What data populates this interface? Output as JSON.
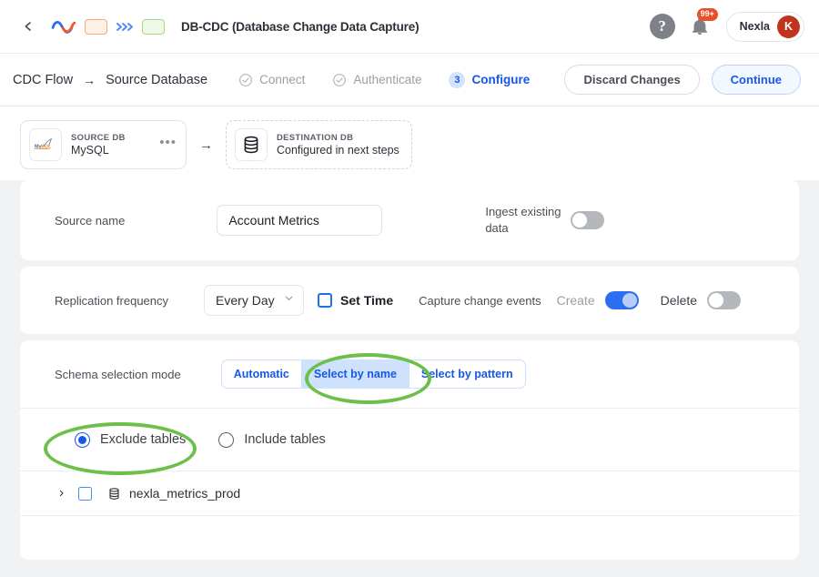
{
  "topbar": {
    "back_icon": "chevron-left-icon",
    "logo_icon": "nexla-zigzag-logo",
    "chip_orange": "",
    "chevrons_icon": "triple-chevron-right-icon",
    "chip_green": "",
    "title": "DB-CDC (Database Change Data Capture)",
    "help_label": "?",
    "bell_icon": "bell-icon",
    "notification_count": "99+",
    "user_name": "Nexla",
    "avatar_initial": "K"
  },
  "steprow": {
    "breadcrumb_root": "CDC Flow",
    "breadcrumb_arrow": "→",
    "breadcrumb_current": "Source Database",
    "steps": [
      {
        "label": "Connect",
        "state": "done"
      },
      {
        "label": "Authenticate",
        "state": "done"
      },
      {
        "label": "Configure",
        "state": "active",
        "number": "3"
      }
    ],
    "discard_label": "Discard Changes",
    "continue_label": "Continue"
  },
  "dbstrip": {
    "source": {
      "kicker": "SOURCE DB",
      "name": "MySQL",
      "logo_icon": "mysql-logo",
      "menu_icon": "ellipsis-icon"
    },
    "arrow": "→",
    "destination": {
      "kicker": "DESTINATION DB",
      "name": "Configured in next steps",
      "icon": "database-icon"
    }
  },
  "form": {
    "source_name": {
      "label": "Source name",
      "value": "Account Metrics",
      "placeholder": "Source name"
    },
    "ingest_existing": {
      "label": "Ingest existing data",
      "label_line1": "Ingest existing",
      "label_line2": "data",
      "enabled": false
    },
    "replication": {
      "label": "Replication frequency",
      "value": "Every Day",
      "options": [
        "Every Day"
      ],
      "set_time_label": "Set Time",
      "set_time_checked": false
    },
    "capture_change_events": {
      "label": "Capture change events",
      "create_label": "Create",
      "create_enabled": true,
      "delete_label": "Delete",
      "delete_enabled": false
    },
    "schema_selection": {
      "label": "Schema selection mode",
      "options": [
        "Automatic",
        "Select by name",
        "Select by pattern"
      ],
      "selected": "Select by name"
    },
    "table_mode": {
      "exclude_label": "Exclude tables",
      "include_label": "Include tables",
      "selected": "Exclude tables"
    },
    "tables": [
      {
        "name": "nexla_metrics_prod",
        "checked": false,
        "expanded": false,
        "icon": "database-icon"
      }
    ]
  },
  "annotations": [
    {
      "name": "highlight-select-by-name",
      "color": "#6cc04a"
    },
    {
      "name": "highlight-exclude-tables",
      "color": "#6cc04a"
    }
  ],
  "colors": {
    "accent_blue": "#1757e8",
    "toggle_on": "#2c6ef2",
    "annotation_green": "#6cc04a",
    "badge_red": "#e8502a",
    "avatar_red": "#c0341d",
    "page_bg": "#f1f2f4"
  }
}
